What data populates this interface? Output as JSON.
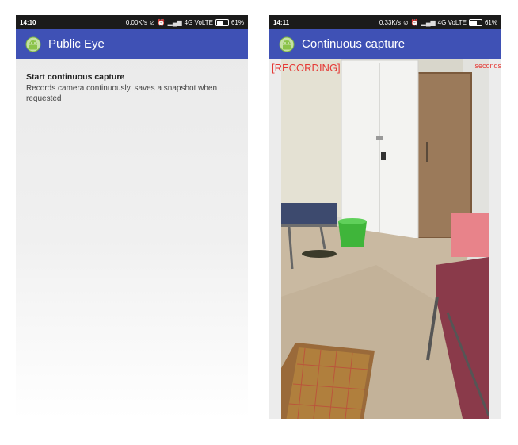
{
  "left_screen": {
    "status": {
      "time": "14:10",
      "speed": "0.00K/s",
      "network": "4G VoLTE",
      "battery": "61%"
    },
    "app_title": "Public Eye",
    "menu_item": {
      "title": "Start continuous capture",
      "subtitle": "Records camera continuously, saves a snapshot when requested"
    }
  },
  "right_screen": {
    "status": {
      "time": "14:11",
      "speed": "0.33K/s",
      "network": "4G VoLTE",
      "battery": "61%"
    },
    "app_title": "Continuous capture",
    "overlay": {
      "recording_label": "[RECORDING]",
      "timer": "seconds"
    }
  },
  "colors": {
    "app_bar": "#3f51b5",
    "status_bar": "#1b1b1b",
    "overlay_text": "#e53935"
  },
  "icons": [
    "android-app-icon",
    "wifi-off-icon",
    "alarm-icon",
    "signal-icon",
    "battery-icon"
  ]
}
